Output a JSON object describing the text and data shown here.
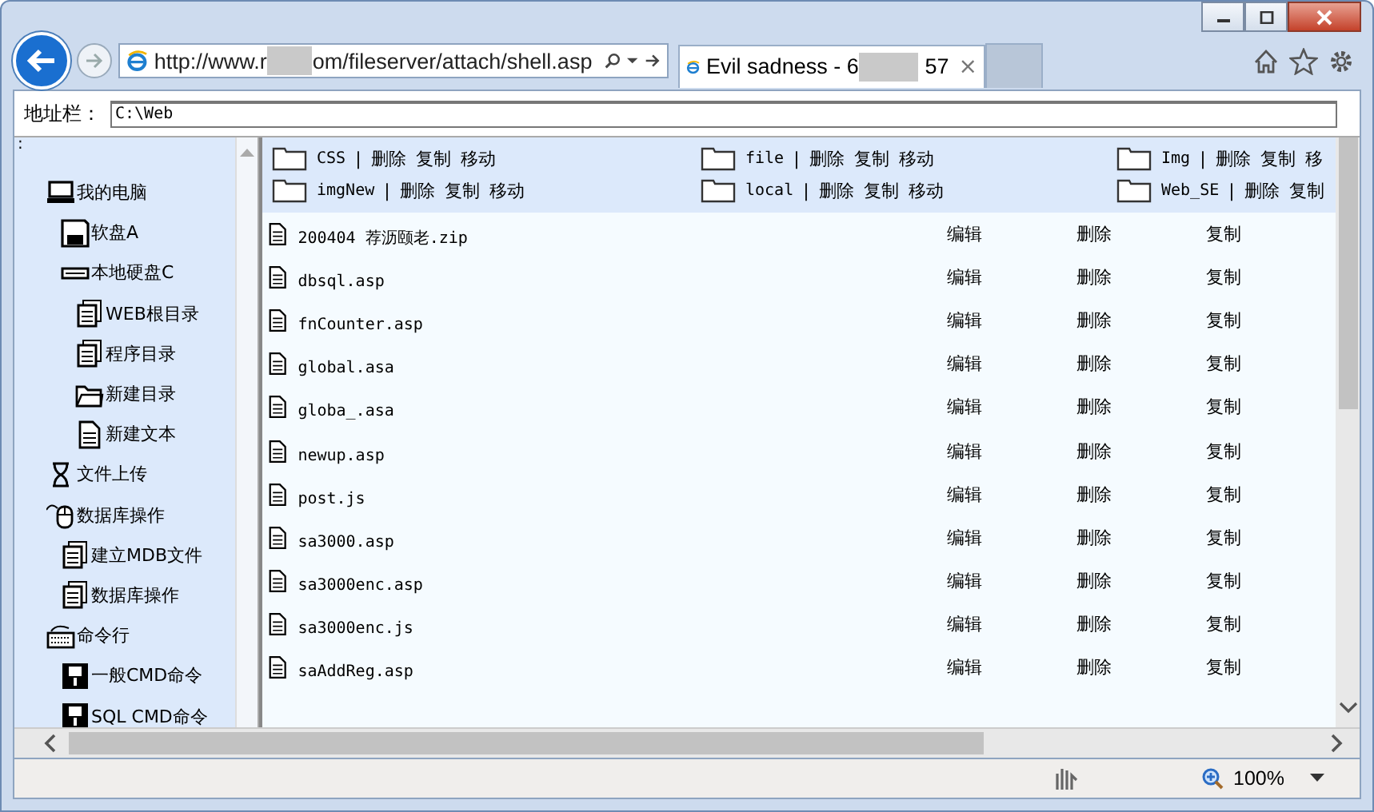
{
  "browser": {
    "url_start": "http://www.r",
    "url_end": "om/fileserver/attach/shell.asp",
    "tab": {
      "title_start": "Evil sadness - 6",
      "title_end": "57",
      "close": "×"
    },
    "zoom": "100%"
  },
  "address_bar": {
    "label": "地址栏：",
    "value": "C:\\Web"
  },
  "sidebar": {
    "marker": ":",
    "items": [
      {
        "label": "我的电脑",
        "kind": "computer",
        "children": [
          {
            "label": "软盘A",
            "kind": "floppy"
          },
          {
            "label": "本地硬盘C",
            "kind": "drive",
            "children": [
              {
                "label": "WEB根目录",
                "kind": "docs"
              },
              {
                "label": "程序目录",
                "kind": "docs"
              },
              {
                "label": "新建目录",
                "kind": "folder"
              },
              {
                "label": "新建文本",
                "kind": "file"
              }
            ]
          }
        ]
      },
      {
        "label": "文件上传",
        "kind": "hourglass"
      },
      {
        "label": "数据库操作",
        "kind": "mouse",
        "children": [
          {
            "label": "建立MDB文件",
            "kind": "docs"
          },
          {
            "label": "数据库操作",
            "kind": "docs"
          }
        ]
      },
      {
        "label": "命令行",
        "kind": "keyboard",
        "children": [
          {
            "label": "一般CMD命令",
            "kind": "disk"
          },
          {
            "label": "SQL CMD命令",
            "kind": "disk"
          }
        ]
      }
    ]
  },
  "folders": [
    {
      "name": "CSS",
      "actions": [
        "删除",
        "复制",
        "移动"
      ]
    },
    {
      "name": "file",
      "actions": [
        "删除",
        "复制",
        "移动"
      ]
    },
    {
      "name": "Img",
      "actions": [
        "删除",
        "复制",
        "移"
      ]
    },
    {
      "name": "imgNew",
      "actions": [
        "删除",
        "复制",
        "移动"
      ]
    },
    {
      "name": "local",
      "actions": [
        "删除",
        "复制",
        "移动"
      ]
    },
    {
      "name": "Web_SE",
      "actions": [
        "删除",
        "复制"
      ]
    }
  ],
  "folder_separator": "|",
  "files": [
    {
      "name": "200404 荐沥颐老.zip",
      "actions": [
        "编辑",
        "删除",
        "复制"
      ]
    },
    {
      "name": "dbsql.asp",
      "actions": [
        "编辑",
        "删除",
        "复制"
      ]
    },
    {
      "name": "fnCounter.asp",
      "actions": [
        "编辑",
        "删除",
        "复制"
      ]
    },
    {
      "name": "global.asa",
      "actions": [
        "编辑",
        "删除",
        "复制"
      ]
    },
    {
      "name": "globa_.asa",
      "actions": [
        "编辑",
        "删除",
        "复制"
      ]
    },
    {
      "name": "newup.asp",
      "actions": [
        "编辑",
        "删除",
        "复制"
      ]
    },
    {
      "name": "post.js",
      "actions": [
        "编辑",
        "删除",
        "复制"
      ]
    },
    {
      "name": "sa3000.asp",
      "actions": [
        "编辑",
        "删除",
        "复制"
      ]
    },
    {
      "name": "sa3000enc.asp",
      "actions": [
        "编辑",
        "删除",
        "复制"
      ]
    },
    {
      "name": "sa3000enc.js",
      "actions": [
        "编辑",
        "删除",
        "复制"
      ]
    },
    {
      "name": "saAddReg.asp",
      "actions": [
        "编辑",
        "删除",
        "复制"
      ]
    }
  ]
}
